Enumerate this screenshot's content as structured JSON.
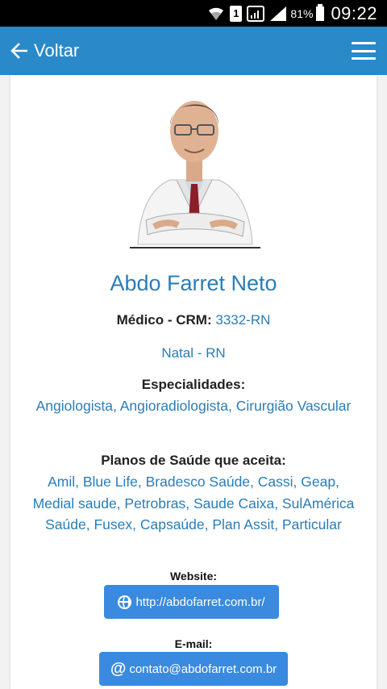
{
  "status_bar": {
    "sim_number": "1",
    "battery_percent": "81%",
    "time": "09:22"
  },
  "app_bar": {
    "back_label": "Voltar"
  },
  "doctor": {
    "name": "Abdo Farret Neto",
    "crm_label": "Médico - CRM:",
    "crm_value": "3332-RN",
    "city": "Natal - RN"
  },
  "specialties": {
    "title": "Especialidades:",
    "text": "Angiologista, Angioradiologista, Cirurgião Vascular"
  },
  "plans": {
    "title": "Planos de Saúde que aceita:",
    "text": "Amil, Blue Life, Bradesco Saúde, Cassi, Geap, Medial saude, Petrobras, Saude Caixa, SulAmérica Saúde, Fusex, Capsaúde, Plan Assit, Particular"
  },
  "website": {
    "title": "Website:",
    "url": "http://abdofarret.com.br/"
  },
  "email": {
    "title": "E-mail:",
    "address": "contato@abdofarret.com.br"
  },
  "colors": {
    "app_bar": "#2a89c8",
    "accent_text": "#2a7db8",
    "button": "#3a8ae0"
  }
}
